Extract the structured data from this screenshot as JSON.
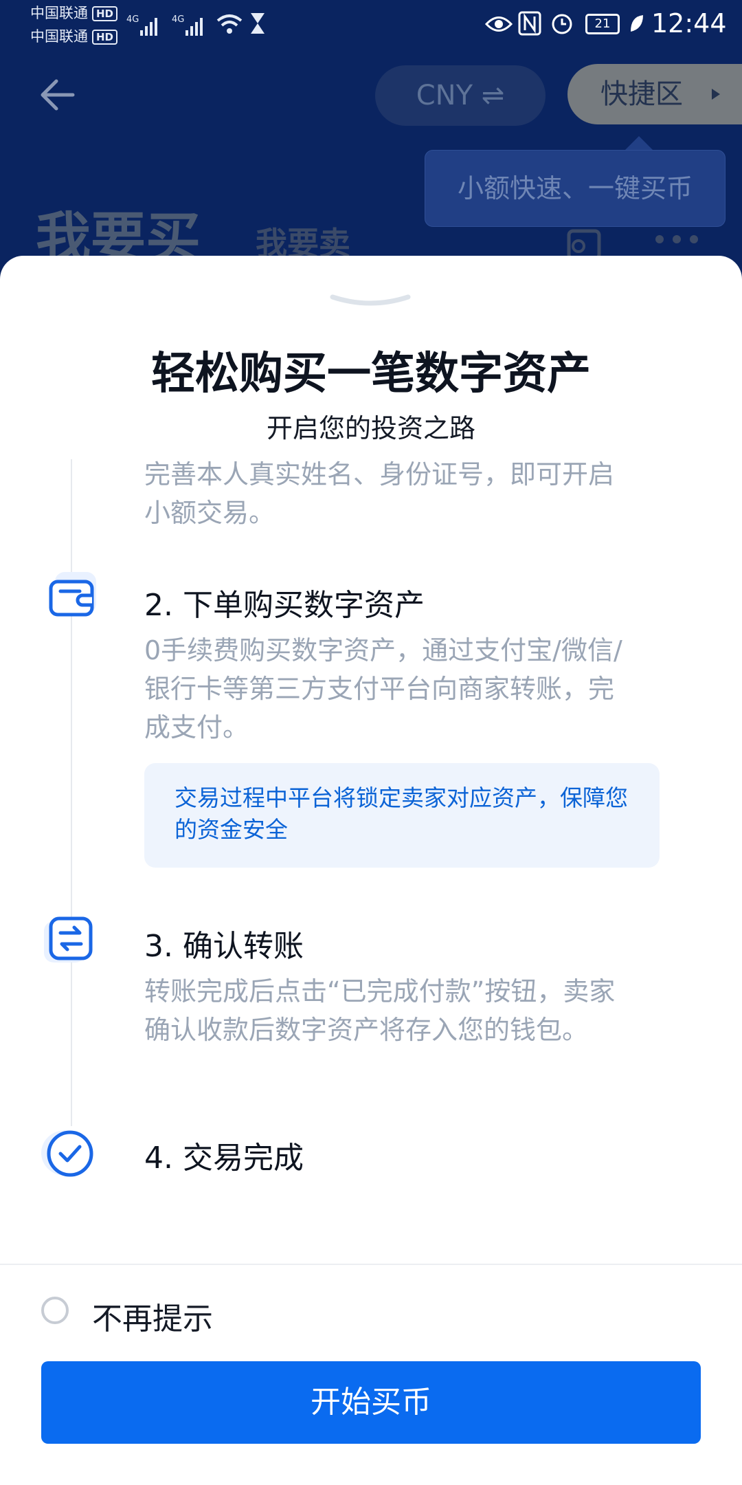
{
  "status_bar": {
    "carrier1": "中国联通",
    "carrier2": "中国联通",
    "hd": "HD",
    "network1": "4G",
    "network2": "4G",
    "battery": "21",
    "time": "12:44"
  },
  "header": {
    "currency_label": "CNY ⇌",
    "quick_area_label": "快捷区",
    "tooltip_text": "小额快速、一键买币",
    "tab_buy": "我要买",
    "tab_sell": "我要卖"
  },
  "sheet": {
    "title": "轻松购买一笔数字资产",
    "subtitle": "开启您的投资之路",
    "step1_desc": "完善本人真实姓名、身份证号，即可开启小额交易。",
    "steps": [
      {
        "title": "2. 下单购买数字资产",
        "desc": "0手续费购买数字资产，通过支付宝/微信/银行卡等第三方支付平台向商家转账，完成支付。",
        "icon": "wallet-icon"
      },
      {
        "title": "3. 确认转账",
        "desc": "转账完成后点击“已完成付款”按钮，卖家确认收款后数字资产将存入您的钱包。",
        "icon": "transfer-icon"
      },
      {
        "title": "4. 交易完成",
        "desc": "",
        "icon": "check-circle-icon"
      }
    ],
    "note": "交易过程中平台将锁定卖家对应资产，保障您的资金安全",
    "dont_show_label": "不再提示",
    "start_button": "开始买币"
  },
  "colors": {
    "primary": "#0a6bf0",
    "header_bg": "#0a2460",
    "note_bg": "#eef4fd"
  }
}
